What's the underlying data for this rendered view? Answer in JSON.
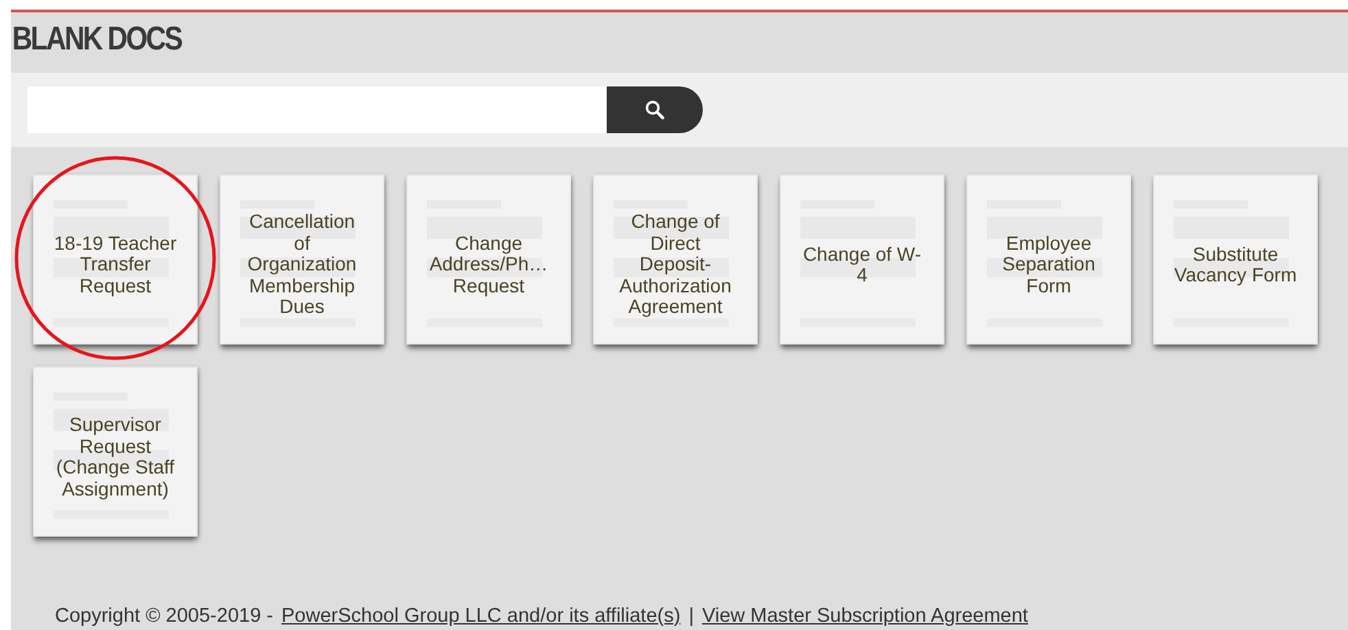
{
  "page": {
    "title": "BLANK DOCS"
  },
  "documents": [
    {
      "title": "18-19 Teacher Transfer Request",
      "highlighted": true
    },
    {
      "title": "Cancellation of Organization Membership Dues",
      "highlighted": false
    },
    {
      "title": "Change Address/Ph… Request",
      "highlighted": false
    },
    {
      "title": "Change of Direct Deposit-Authorization Agreement",
      "highlighted": false
    },
    {
      "title": "Change of W-4",
      "highlighted": false
    },
    {
      "title": "Employee Separation Form",
      "highlighted": false
    },
    {
      "title": "Substitute Vacancy Form",
      "highlighted": false
    },
    {
      "title": "Supervisor Request (Change Staff Assignment)",
      "highlighted": false
    }
  ],
  "footer": {
    "copyright": "Copyright © 2005-2019 -",
    "links": [
      "PowerSchool Group LLC and/or its affiliate(s)",
      "View Master Subscription Agreement"
    ],
    "separator": "|"
  }
}
